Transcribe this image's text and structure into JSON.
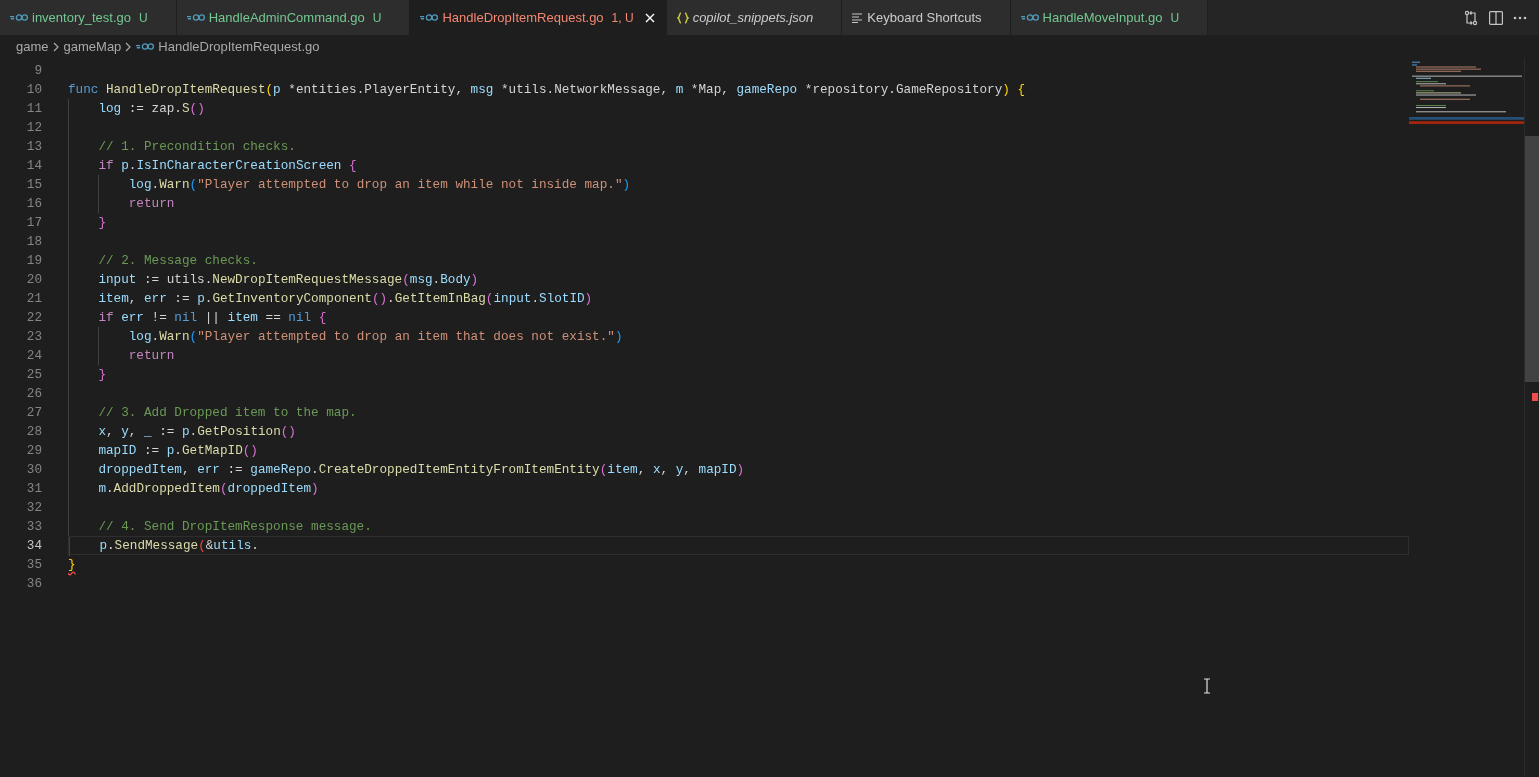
{
  "tabs": [
    {
      "label": "inventory_test.go",
      "kind": "go",
      "badge": "U",
      "color": "#73c991",
      "selected": false,
      "preview": false
    },
    {
      "label": "HandleAdminCommand.go",
      "kind": "go",
      "badge": "U",
      "color": "#73c991",
      "selected": false,
      "preview": false
    },
    {
      "label": "HandleDropItemRequest.go",
      "kind": "go",
      "badge": "1, U",
      "color": "#f48771",
      "selected": true,
      "preview": false
    },
    {
      "label": "copilot_snippets.json",
      "kind": "json",
      "color": "#cccccc",
      "selected": false,
      "preview": true
    },
    {
      "label": "Keyboard Shortcuts",
      "kind": "list",
      "color": "#cccccc",
      "selected": false,
      "preview": false
    },
    {
      "label": "HandleMoveInput.go",
      "kind": "go",
      "badge": "U",
      "color": "#73c991",
      "selected": false,
      "preview": false
    }
  ],
  "breadcrumbs": [
    {
      "label": "game",
      "kind": "folder"
    },
    {
      "label": "gameMap",
      "kind": "folder"
    },
    {
      "label": "HandleDropItemRequest.go",
      "kind": "go"
    }
  ],
  "editor": {
    "lines": [
      {
        "number": "9",
        "current": false
      },
      {
        "number": "10",
        "current": false,
        "tokens": [
          {
            "kind": "keyword",
            "text": "func "
          },
          {
            "kind": "function",
            "text": "HandleDropItemRequest"
          },
          {
            "kind": "bracket1",
            "text": "("
          },
          {
            "kind": "variable",
            "text": "p"
          },
          {
            "kind": "plain",
            "text": " *entities.PlayerEntity, "
          },
          {
            "kind": "variable",
            "text": "msg"
          },
          {
            "kind": "plain",
            "text": " *utils.NetworkMessage, "
          },
          {
            "kind": "variable",
            "text": "m"
          },
          {
            "kind": "plain",
            "text": " *Map, "
          },
          {
            "kind": "variable",
            "text": "gameRepo"
          },
          {
            "kind": "plain",
            "text": " *repository.GameRepository"
          },
          {
            "kind": "bracket1",
            "text": ") "
          },
          {
            "kind": "bracket1",
            "text": "{"
          }
        ]
      },
      {
        "number": "11",
        "current": false,
        "tokens": [
          {
            "kind": "variable",
            "text": "\tlog"
          },
          {
            "kind": "plain",
            "text": " := zap."
          },
          {
            "kind": "function",
            "text": "S"
          },
          {
            "kind": "bracket2",
            "text": "()"
          }
        ]
      },
      {
        "number": "12",
        "current": false
      },
      {
        "number": "13",
        "current": false,
        "tokens": [
          {
            "kind": "comment",
            "text": "\t// 1. Precondition checks."
          }
        ]
      },
      {
        "number": "14",
        "current": false,
        "tokens": [
          {
            "kind": "control",
            "text": "\tif "
          },
          {
            "kind": "variable",
            "text": "p"
          },
          {
            "kind": "plain",
            "text": "."
          },
          {
            "kind": "variable",
            "text": "IsInCharacterCreationScreen "
          },
          {
            "kind": "bracket2",
            "text": "{"
          }
        ]
      },
      {
        "number": "15",
        "current": false,
        "tokens": [
          {
            "kind": "variable",
            "text": "\t\tlog"
          },
          {
            "kind": "plain",
            "text": "."
          },
          {
            "kind": "function",
            "text": "Warn"
          },
          {
            "kind": "bracket3",
            "text": "("
          },
          {
            "kind": "string",
            "text": "\"Player attempted to drop an item while not inside map.\""
          },
          {
            "kind": "bracket3",
            "text": ")"
          }
        ]
      },
      {
        "number": "16",
        "current": false,
        "tokens": [
          {
            "kind": "control",
            "text": "\t\treturn"
          }
        ]
      },
      {
        "number": "17",
        "current": false,
        "tokens": [
          {
            "kind": "bracket2",
            "text": "\t}"
          }
        ]
      },
      {
        "number": "18",
        "current": false
      },
      {
        "number": "19",
        "current": false,
        "tokens": [
          {
            "kind": "comment",
            "text": "\t// 2. Message checks."
          }
        ]
      },
      {
        "number": "20",
        "current": false,
        "tokens": [
          {
            "kind": "variable",
            "text": "\tinput"
          },
          {
            "kind": "plain",
            "text": " := utils."
          },
          {
            "kind": "function",
            "text": "NewDropItemRequestMessage"
          },
          {
            "kind": "bracket2",
            "text": "("
          },
          {
            "kind": "variable",
            "text": "msg"
          },
          {
            "kind": "plain",
            "text": "."
          },
          {
            "kind": "variable",
            "text": "Body"
          },
          {
            "kind": "bracket2",
            "text": ")"
          }
        ]
      },
      {
        "number": "21",
        "current": false,
        "tokens": [
          {
            "kind": "variable",
            "text": "\titem"
          },
          {
            "kind": "plain",
            "text": ", "
          },
          {
            "kind": "variable",
            "text": "err"
          },
          {
            "kind": "plain",
            "text": " := "
          },
          {
            "kind": "variable",
            "text": "p"
          },
          {
            "kind": "plain",
            "text": "."
          },
          {
            "kind": "function",
            "text": "GetInventoryComponent"
          },
          {
            "kind": "bracket2",
            "text": "()"
          },
          {
            "kind": "plain",
            "text": "."
          },
          {
            "kind": "function",
            "text": "GetItemInBag"
          },
          {
            "kind": "bracket2",
            "text": "("
          },
          {
            "kind": "variable",
            "text": "input"
          },
          {
            "kind": "plain",
            "text": "."
          },
          {
            "kind": "variable",
            "text": "SlotID"
          },
          {
            "kind": "bracket2",
            "text": ")"
          }
        ]
      },
      {
        "number": "22",
        "current": false,
        "tokens": [
          {
            "kind": "control",
            "text": "\tif "
          },
          {
            "kind": "variable",
            "text": "err"
          },
          {
            "kind": "plain",
            "text": " != "
          },
          {
            "kind": "keyword",
            "text": "nil"
          },
          {
            "kind": "plain",
            "text": " || "
          },
          {
            "kind": "variable",
            "text": "item"
          },
          {
            "kind": "plain",
            "text": " == "
          },
          {
            "kind": "keyword",
            "text": "nil "
          },
          {
            "kind": "bracket2",
            "text": "{"
          }
        ]
      },
      {
        "number": "23",
        "current": false,
        "tokens": [
          {
            "kind": "variable",
            "text": "\t\tlog"
          },
          {
            "kind": "plain",
            "text": "."
          },
          {
            "kind": "function",
            "text": "Warn"
          },
          {
            "kind": "bracket3",
            "text": "("
          },
          {
            "kind": "string",
            "text": "\"Player attempted to drop an item that does not exist.\""
          },
          {
            "kind": "bracket3",
            "text": ")"
          }
        ]
      },
      {
        "number": "24",
        "current": false,
        "tokens": [
          {
            "kind": "control",
            "text": "\t\treturn"
          }
        ]
      },
      {
        "number": "25",
        "current": false,
        "tokens": [
          {
            "kind": "bracket2",
            "text": "\t}"
          }
        ]
      },
      {
        "number": "26",
        "current": false
      },
      {
        "number": "27",
        "current": false,
        "tokens": [
          {
            "kind": "comment",
            "text": "\t// 3. Add Dropped item to the map."
          }
        ]
      },
      {
        "number": "28",
        "current": false,
        "tokens": [
          {
            "kind": "variable",
            "text": "\tx"
          },
          {
            "kind": "plain",
            "text": ", "
          },
          {
            "kind": "variable",
            "text": "y"
          },
          {
            "kind": "plain",
            "text": ", "
          },
          {
            "kind": "variable",
            "text": "_"
          },
          {
            "kind": "plain",
            "text": " := "
          },
          {
            "kind": "variable",
            "text": "p"
          },
          {
            "kind": "plain",
            "text": "."
          },
          {
            "kind": "function",
            "text": "GetPosition"
          },
          {
            "kind": "bracket2",
            "text": "()"
          }
        ]
      },
      {
        "number": "29",
        "current": false,
        "tokens": [
          {
            "kind": "variable",
            "text": "\tmapID"
          },
          {
            "kind": "plain",
            "text": " := "
          },
          {
            "kind": "variable",
            "text": "p"
          },
          {
            "kind": "plain",
            "text": "."
          },
          {
            "kind": "function",
            "text": "GetMapID"
          },
          {
            "kind": "bracket2",
            "text": "()"
          }
        ]
      },
      {
        "number": "30",
        "current": false,
        "tokens": [
          {
            "kind": "variable",
            "text": "\tdroppedItem"
          },
          {
            "kind": "plain",
            "text": ", "
          },
          {
            "kind": "variable",
            "text": "err"
          },
          {
            "kind": "plain",
            "text": " := "
          },
          {
            "kind": "variable",
            "text": "gameRepo"
          },
          {
            "kind": "plain",
            "text": "."
          },
          {
            "kind": "function",
            "text": "CreateDroppedItemEntityFromItemEntity"
          },
          {
            "kind": "bracket2",
            "text": "("
          },
          {
            "kind": "variable",
            "text": "item"
          },
          {
            "kind": "plain",
            "text": ", "
          },
          {
            "kind": "variable",
            "text": "x"
          },
          {
            "kind": "plain",
            "text": ", "
          },
          {
            "kind": "variable",
            "text": "y"
          },
          {
            "kind": "plain",
            "text": ", "
          },
          {
            "kind": "variable",
            "text": "mapID"
          },
          {
            "kind": "bracket2",
            "text": ")"
          }
        ]
      },
      {
        "number": "31",
        "current": false,
        "tokens": [
          {
            "kind": "variable",
            "text": "\tm"
          },
          {
            "kind": "plain",
            "text": "."
          },
          {
            "kind": "function",
            "text": "AddDroppedItem"
          },
          {
            "kind": "bracket2",
            "text": "("
          },
          {
            "kind": "variable",
            "text": "droppedItem"
          },
          {
            "kind": "bracket2",
            "text": ")"
          }
        ]
      },
      {
        "number": "32",
        "current": false
      },
      {
        "number": "33",
        "current": false,
        "tokens": [
          {
            "kind": "comment",
            "text": "\t// 4. Send DropItemResponse message."
          }
        ]
      },
      {
        "number": "34",
        "current": true,
        "tokens": [
          {
            "kind": "variable",
            "text": "\tp"
          },
          {
            "kind": "plain",
            "text": "."
          },
          {
            "kind": "function",
            "text": "SendMessage"
          },
          {
            "kind": "unmatched",
            "text": "("
          },
          {
            "kind": "plain",
            "text": "&"
          },
          {
            "kind": "variable",
            "text": "utils"
          },
          {
            "kind": "plain",
            "text": "."
          }
        ]
      },
      {
        "number": "35",
        "current": false,
        "tokens": [
          {
            "kind": "bracket1",
            "text": "}",
            "error": true
          }
        ]
      },
      {
        "number": "36",
        "current": false
      }
    ]
  }
}
